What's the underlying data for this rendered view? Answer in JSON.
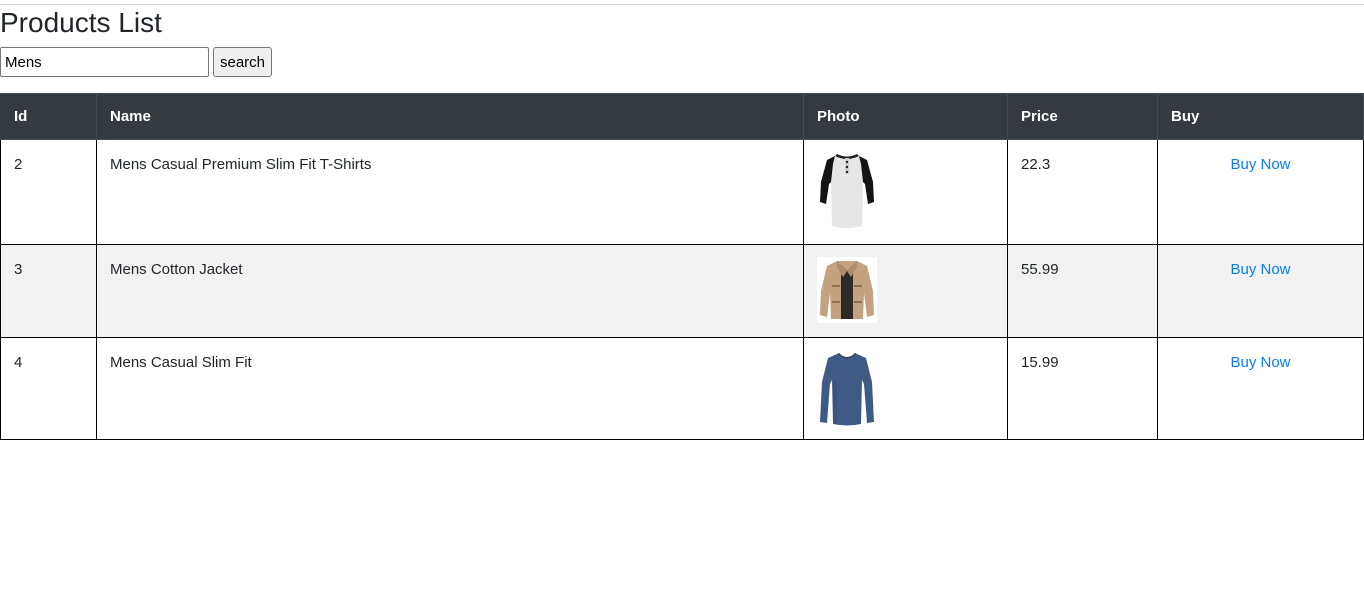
{
  "page": {
    "title": "Products List"
  },
  "search": {
    "value": "Mens",
    "button_label": "search"
  },
  "table": {
    "headers": {
      "id": "Id",
      "name": "Name",
      "photo": "Photo",
      "price": "Price",
      "buy": "Buy"
    },
    "rows": [
      {
        "id": "2",
        "name": "Mens Casual Premium Slim Fit T-Shirts",
        "photo_icon": "henley-tshirt-image",
        "price": "22.3",
        "buy_label": "Buy Now"
      },
      {
        "id": "3",
        "name": "Mens Cotton Jacket",
        "photo_icon": "khaki-jacket-image",
        "price": "55.99",
        "buy_label": "Buy Now"
      },
      {
        "id": "4",
        "name": "Mens Casual Slim Fit",
        "photo_icon": "blue-longsleeve-image",
        "price": "15.99",
        "buy_label": "Buy Now"
      }
    ]
  },
  "colors": {
    "header_bg": "#343a40",
    "link": "#0b7ee6",
    "stripe": "#f2f2f2"
  }
}
